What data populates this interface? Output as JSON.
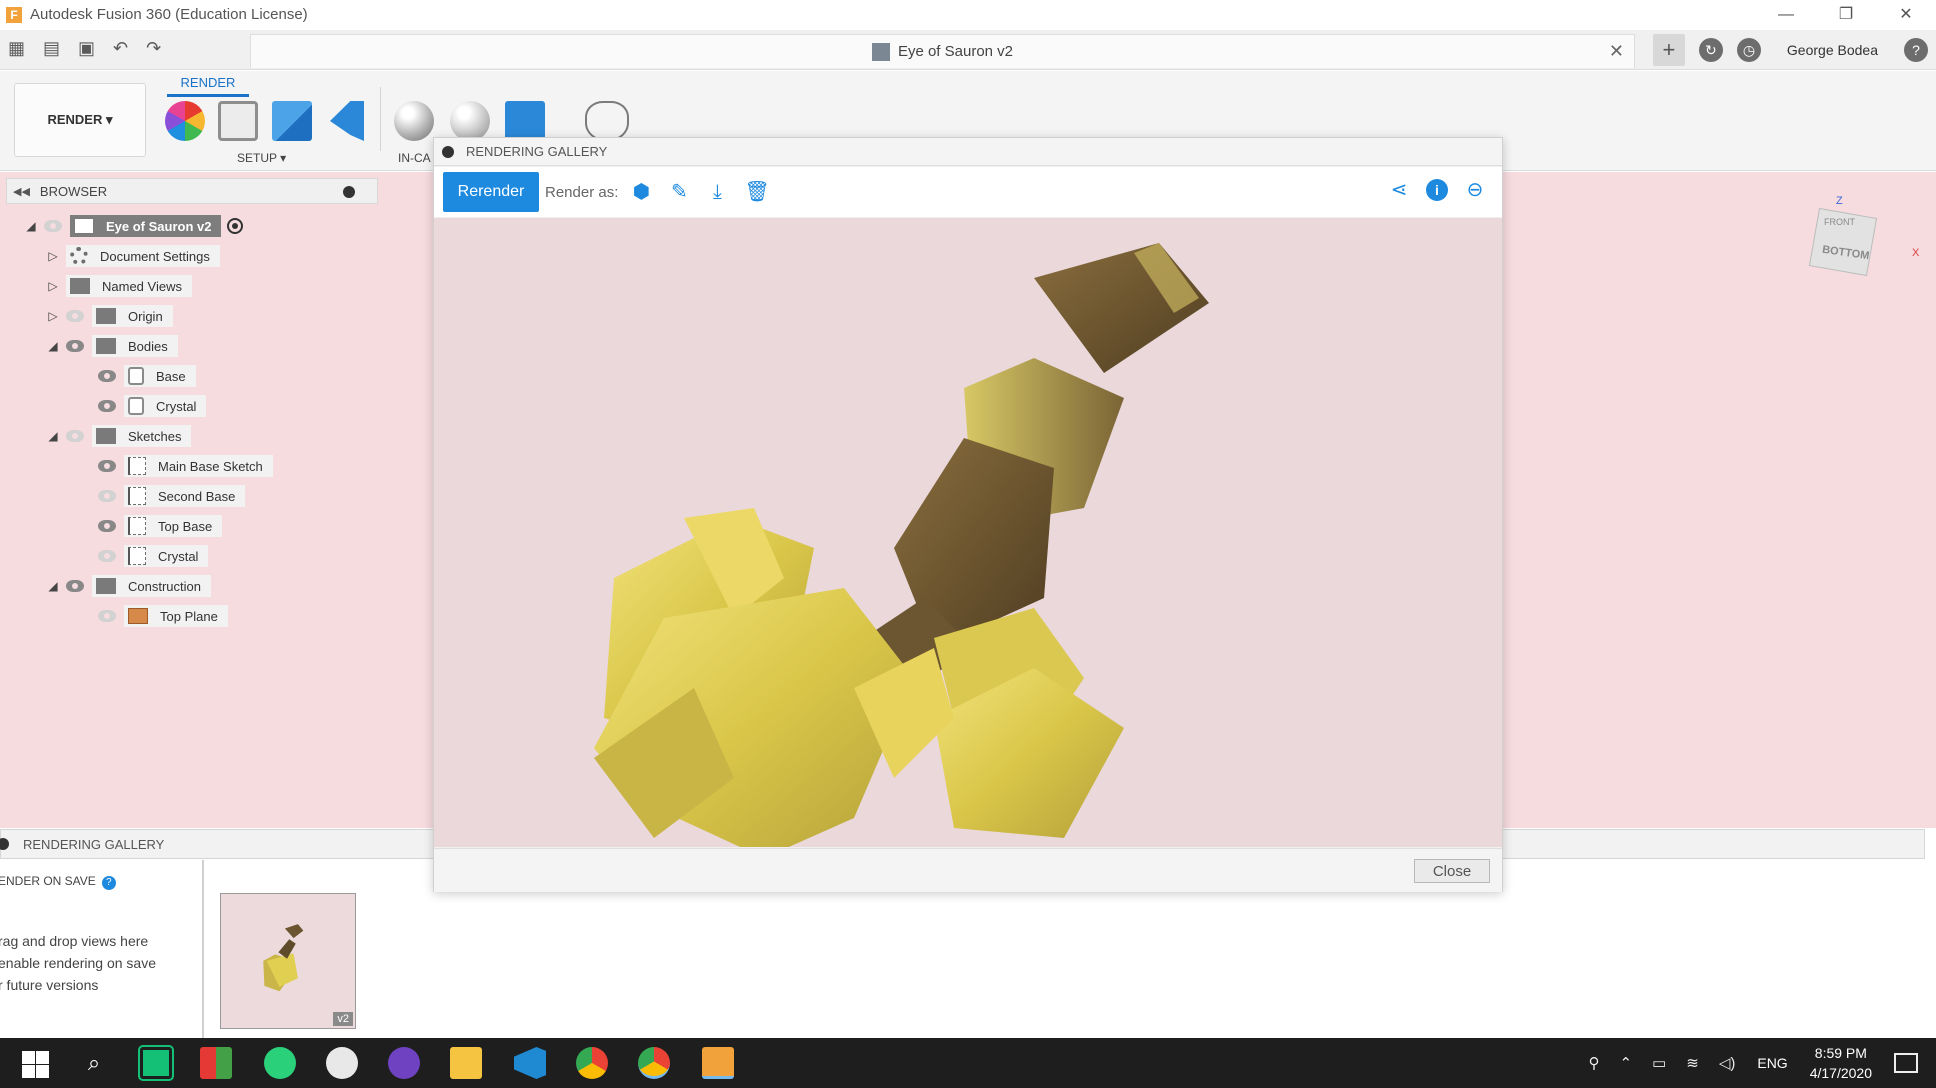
{
  "window": {
    "app_icon_letter": "F",
    "title": "Autodesk Fusion 360 (Education License)",
    "minimize": "—",
    "restore": "❐",
    "close": "✕"
  },
  "quick_access": {
    "doc_title": "Eye of Sauron v2",
    "doc_close": "✕",
    "user_name": "George Bodea",
    "help": "?"
  },
  "ribbon": {
    "workspace_label": "RENDER ▾",
    "active_tab": "RENDER",
    "setup_label": "SETUP ▾",
    "incanvas_label": "IN-CA"
  },
  "browser": {
    "title": "BROWSER",
    "items": [
      {
        "label": "Eye of Sauron v2"
      },
      {
        "label": "Document Settings"
      },
      {
        "label": "Named Views"
      },
      {
        "label": "Origin"
      },
      {
        "label": "Bodies"
      },
      {
        "label": "Base"
      },
      {
        "label": "Crystal"
      },
      {
        "label": "Sketches"
      },
      {
        "label": "Main Base Sketch"
      },
      {
        "label": "Second Base"
      },
      {
        "label": "Top Base"
      },
      {
        "label": "Crystal"
      },
      {
        "label": "Construction"
      },
      {
        "label": "Top Plane"
      }
    ]
  },
  "viewcube": {
    "front": "FRONT",
    "bottom": "BOTTOM",
    "axis_z": "Z",
    "axis_x": "X"
  },
  "gallery_modal": {
    "title": "RENDERING GALLERY",
    "rerender": "Rerender",
    "render_as": "Render as:",
    "close": "Close"
  },
  "bottom_gallery": {
    "title": "RENDERING GALLERY",
    "render_on_save": "ENDER ON SAVE",
    "help": "?",
    "drag_text_1": "rag and drop views here",
    "drag_text_2": " enable rendering on save",
    "drag_text_3": "r future versions",
    "thumb_version": "v2"
  },
  "taskbar": {
    "language": "ENG",
    "time": "8:59 PM",
    "date": "4/17/2020"
  },
  "colors": {
    "accent": "#1d8ae0",
    "canvas": "#f6dbdf",
    "render_bg": "#ead8da",
    "crystal_yellow": "#e6d55a",
    "taskbar": "#1e1e1e"
  }
}
